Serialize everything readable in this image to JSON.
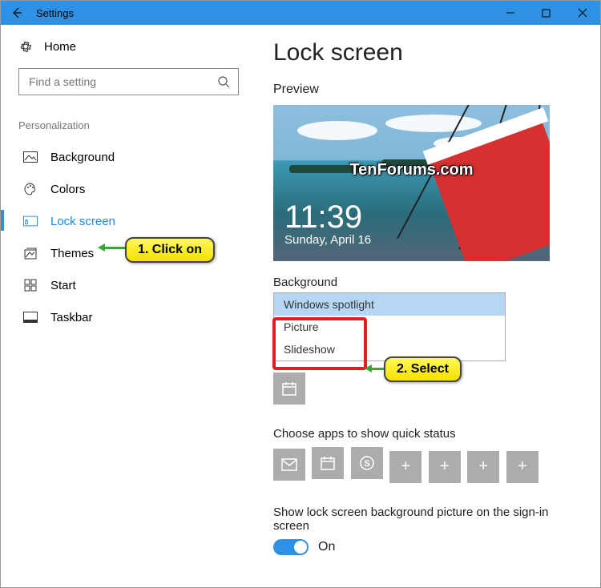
{
  "window": {
    "title": "Settings"
  },
  "sidebar": {
    "home": "Home",
    "search_placeholder": "Find a setting",
    "section": "Personalization",
    "items": [
      {
        "label": "Background"
      },
      {
        "label": "Colors"
      },
      {
        "label": "Lock screen"
      },
      {
        "label": "Themes"
      },
      {
        "label": "Start"
      },
      {
        "label": "Taskbar"
      }
    ]
  },
  "main": {
    "heading": "Lock screen",
    "preview_label": "Preview",
    "watermark": "TenForums.com",
    "clock_time": "11:39",
    "clock_date": "Sunday, April 16",
    "background_label": "Background",
    "dropdown": {
      "options": [
        "Windows spotlight",
        "Picture",
        "Slideshow"
      ],
      "selected": "Windows spotlight"
    },
    "quick_status_label": "Choose apps to show quick status",
    "signin_label": "Show lock screen background picture on the sign-in screen",
    "toggle_state": "On"
  },
  "callouts": {
    "step1": "1. Click on",
    "step2": "2. Select"
  }
}
